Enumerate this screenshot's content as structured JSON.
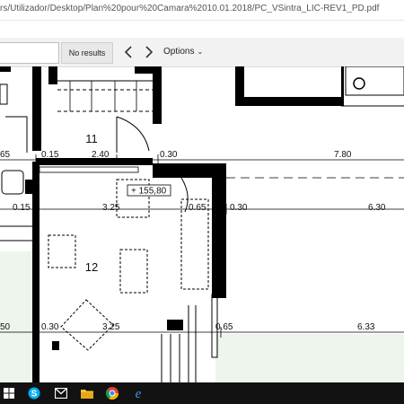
{
  "window": {
    "title": "rs/Utilizador/Desktop/Plan%20pour%20Camara%2010.01.2018/PC_VSintra_LIC-REV1_PD.pdf"
  },
  "find_toolbar": {
    "search_value": "",
    "results_label": "No results",
    "prev_icon": "chevron-left-icon",
    "next_icon": "chevron-right-icon",
    "options_label": "Options"
  },
  "plan": {
    "rooms": [
      {
        "id": "11",
        "label": "11"
      },
      {
        "id": "12",
        "label": "12"
      }
    ],
    "level_marker": "+ 155,80",
    "row1_dims": [
      "65",
      "0.15",
      "2.40",
      "0.30",
      "7.80"
    ],
    "row2_dims": [
      "0.15",
      "3.25",
      "0.65",
      "0.30",
      "6.30"
    ],
    "row3_dims": [
      "50",
      "0.30",
      "3.25",
      "0.65",
      "6.33"
    ]
  },
  "taskbar": {
    "icons": [
      "windows-start-icon",
      "skype-icon",
      "mail-icon",
      "file-explorer-icon",
      "chrome-icon",
      "edge-icon"
    ]
  }
}
